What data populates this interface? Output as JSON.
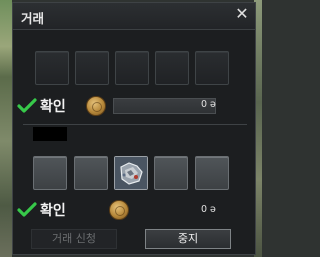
{
  "window": {
    "title": "거래",
    "close_icon": "close-icon"
  },
  "partner": {
    "confirm_label": "확인",
    "money": "0",
    "money_unit": "ə",
    "check_color": "#37c94a"
  },
  "self": {
    "confirm_label": "확인",
    "money": "0",
    "money_unit": "ə",
    "check_color": "#37c94a"
  },
  "buttons": {
    "request_label": "거래 신청",
    "stop_label": "중지"
  },
  "icons": {
    "coin": "coin-icon",
    "check": "check-icon",
    "item": "armor-item-icon"
  }
}
